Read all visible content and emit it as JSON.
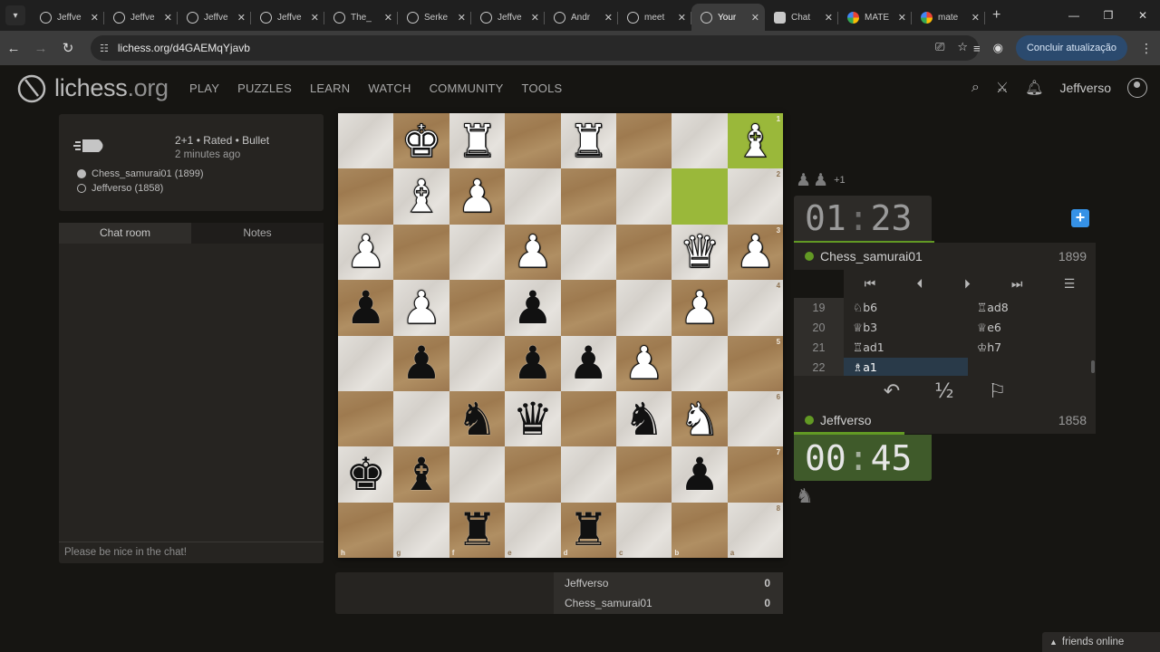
{
  "browser": {
    "tabs": [
      {
        "title": "Jeffve",
        "favicon": "lichess-icon",
        "active": false
      },
      {
        "title": "Jeffve",
        "favicon": "lichess-icon",
        "active": false
      },
      {
        "title": "Jeffve",
        "favicon": "lichess-icon",
        "active": false
      },
      {
        "title": "Jeffve",
        "favicon": "lichess-icon",
        "active": false
      },
      {
        "title": "The_",
        "favicon": "lichess-icon",
        "active": false
      },
      {
        "title": "Serke",
        "favicon": "lichess-icon",
        "active": false
      },
      {
        "title": "Jeffve",
        "favicon": "lichess-icon",
        "active": false
      },
      {
        "title": "Andr",
        "favicon": "lichess-icon",
        "active": false
      },
      {
        "title": "meet",
        "favicon": "lichess-icon",
        "active": false
      },
      {
        "title": "Your",
        "favicon": "lichess-icon",
        "active": true
      },
      {
        "title": "Chat",
        "favicon": "chatgpt-icon",
        "active": false
      },
      {
        "title": "MATE",
        "favicon": "google-icon",
        "active": false
      },
      {
        "title": "mate",
        "favicon": "google-icon",
        "active": false
      }
    ],
    "url": "lichess.org/d4GAEMqYjavb",
    "update_button": "Concluir atualização"
  },
  "site": {
    "logo_main": "lichess",
    "logo_tld": ".org",
    "nav": [
      "PLAY",
      "PUZZLES",
      "LEARN",
      "WATCH",
      "COMMUNITY",
      "TOOLS"
    ],
    "username": "Jeffverso"
  },
  "game_info": {
    "type": "2+1 • Rated • Bullet",
    "time_ago": "2 minutes ago",
    "players": [
      {
        "name": "Chess_samurai01 (1899)",
        "color": "black"
      },
      {
        "name": "Jeffverso (1858)",
        "color": "white"
      }
    ]
  },
  "chat": {
    "tabs": [
      "Chat room",
      "Notes"
    ],
    "placeholder": "Please be nice in the chat!"
  },
  "board": {
    "orientation": "black",
    "files": [
      "h",
      "g",
      "f",
      "e",
      "d",
      "c",
      "b",
      "a"
    ],
    "ranks": [
      "1",
      "2",
      "3",
      "4",
      "5",
      "6",
      "7",
      "8"
    ],
    "rows": [
      [
        "",
        "wK",
        "wR",
        "",
        "wR",
        "",
        "",
        "wB"
      ],
      [
        "",
        "wB",
        "wP",
        "",
        "",
        "",
        "",
        ""
      ],
      [
        "wP",
        "",
        "",
        "wP",
        "",
        "",
        "wQ",
        "wP"
      ],
      [
        "bP",
        "wP",
        "",
        "bP",
        "",
        "",
        "wP",
        ""
      ],
      [
        "",
        "bP",
        "",
        "bP",
        "bP",
        "wP",
        "",
        ""
      ],
      [
        "",
        "",
        "bN",
        "bQ",
        "",
        "bN",
        "wN",
        ""
      ],
      [
        "bK",
        "bB",
        "",
        "",
        "",
        "",
        "bP",
        ""
      ],
      [
        "",
        "",
        "bR",
        "",
        "bR",
        "",
        "",
        ""
      ]
    ],
    "highlights": [
      "a1",
      "b2"
    ]
  },
  "crosstable": [
    {
      "name": "Jeffverso",
      "score": "0"
    },
    {
      "name": "Chess_samurai01",
      "score": "0"
    }
  ],
  "panel": {
    "top_material": {
      "pieces": [
        "♟",
        "♟"
      ],
      "diff": "+1"
    },
    "top_clock": {
      "minutes": "01",
      "seconds": "23"
    },
    "top_player": {
      "name": "Chess_samurai01",
      "rating": "1899"
    },
    "bottom_player": {
      "name": "Jeffverso",
      "rating": "1858"
    },
    "bottom_clock": {
      "minutes": "00",
      "seconds": "45"
    },
    "bottom_material": "♞",
    "top_clock_remaining_fraction": 0.7,
    "bottom_clock_remaining_fraction": 0.38,
    "moves": [
      {
        "no": "19",
        "white": "♘b6",
        "black": "♖ad8"
      },
      {
        "no": "20",
        "white": "♕b3",
        "black": "♕e6"
      },
      {
        "no": "21",
        "white": "♖ad1",
        "black": "♔h7"
      },
      {
        "no": "22",
        "white": "♗a1",
        "black": ""
      }
    ],
    "current_move": "22.white",
    "half_label": "½"
  },
  "friends": "friends online",
  "colors": {
    "accent_green": "#629924",
    "accent_blue": "#3692e7",
    "highlight": "#c9d45a"
  }
}
